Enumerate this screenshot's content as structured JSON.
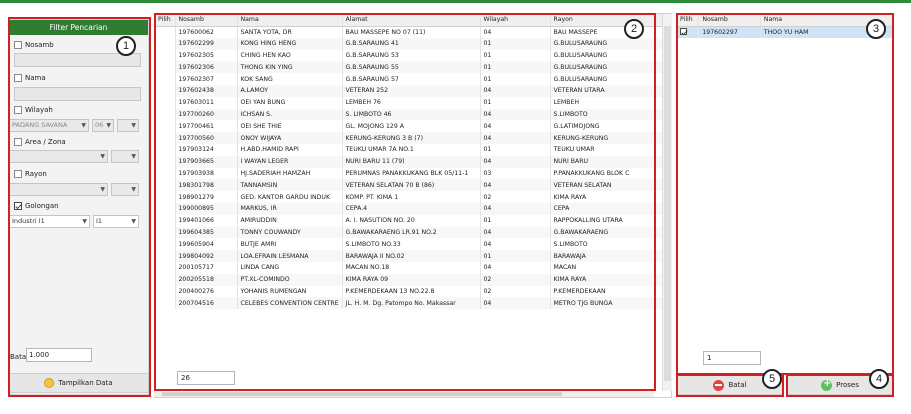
{
  "filter": {
    "title": "Filter Pencarian",
    "nosamb_label": "Nosamb",
    "nama_label": "Nama",
    "wilayah_label": "Wilayah",
    "wilayah_value": "PADANG SAVANA",
    "wilayah_code": "06",
    "area_label": "Area / Zona",
    "rayon_label": "Rayon",
    "golongan_label": "Golongan",
    "golongan_value": "Industri I1",
    "golongan_code": "I1",
    "batas_label": "Batas",
    "batas_value": "1.000",
    "show_button": "Tampilkan Data"
  },
  "main_grid": {
    "columns": [
      "Pilih",
      "Nosamb",
      "Nama",
      "Alamat",
      "Wilayah",
      "Rayon"
    ],
    "rows": [
      [
        "197600062",
        "SANTA YOTA, DR",
        "BAU MASSEPE NO 07 (11)",
        "04",
        "BAU MASSEPE"
      ],
      [
        "197602299",
        "KONG HING HENG",
        "G.B.SARAUNG 41",
        "01",
        "G.BULUSARAUNG"
      ],
      [
        "197602305",
        "CHING HEN KAO",
        "G.B.SARAUNG 53",
        "01",
        "G.BULUSARAUNG"
      ],
      [
        "197602306",
        "THONG KIN YING",
        "G.B.SARAUNG 55",
        "01",
        "G.BULUSARAUNG"
      ],
      [
        "197602307",
        "KOK SANG",
        "G.B.SARAUNG 57",
        "01",
        "G.BULUSARAUNG"
      ],
      [
        "197602438",
        "A.LAMOY",
        "VETERAN 252",
        "04",
        "VETERAN UTARA"
      ],
      [
        "197603011",
        "OEI YAN BUNG",
        "LEMBEH 76",
        "01",
        "LEMBEH"
      ],
      [
        "197700260",
        "ICHSAN S.",
        "S. LIMBOTO 46",
        "04",
        "S.LIMBOTO"
      ],
      [
        "197700461",
        "OEI SHE THIE",
        "GL. MOJONG 129 A",
        "04",
        "G.LATIMOJONG"
      ],
      [
        "197700560",
        "ONOY WIJAYA",
        "KERUNG-KERUNG 3 B (7)",
        "04",
        "KERUNG-KERUNG"
      ],
      [
        "197903124",
        "H.ABD.HAMID RAPI",
        "TEUKU UMAR 7A NO.1",
        "01",
        "TEUKU UMAR"
      ],
      [
        "197903665",
        "I WAYAN LEGER",
        "NURI BARU 11 (79)",
        "04",
        "NURI BARU"
      ],
      [
        "197903938",
        "HJ.SADERIAH HAMZAH",
        "PERUMNAS PANAKKUKANG BLK 05/11-1",
        "03",
        "P.PANAKKUKANG BLOK C"
      ],
      [
        "198301798",
        "TANNAMSIN",
        "VETERAN SELATAN 70 B (86)",
        "04",
        "VETERAN SELATAN"
      ],
      [
        "198901279",
        "GED. KANTOR GARDU INDUK",
        "KOMP. PT. KIMA 1",
        "02",
        "KIMA RAYA"
      ],
      [
        "199000895",
        "MARKUS, IR",
        "CEPA.4",
        "04",
        "CEPA"
      ],
      [
        "199401066",
        "AMIRUDDIN",
        "A. I. NASUTION NO. 20",
        "01",
        "RAPPOKALLING UTARA"
      ],
      [
        "199604385",
        "TONNY COUWANDY",
        "G.BAWAKARAENG LR.91 NO.2",
        "04",
        "G.BAWAKARAENG"
      ],
      [
        "199605904",
        "BUTJE AMRI",
        "S.LIMBOTO NO.33",
        "04",
        "S.LIMBOTO"
      ],
      [
        "199804092",
        "LOA.EFRAIN LESMANA",
        "BARAWAJA II NO.02",
        "01",
        "BARAWAJA"
      ],
      [
        "200105717",
        "LINDA CANG",
        "MACAN NO.18",
        "04",
        "MACAN"
      ],
      [
        "200205518",
        "PT.XL-COMINDO",
        "KIMA RAYA 09",
        "02",
        "KIMA RAYA"
      ],
      [
        "200400276",
        "YOHANIS RUMENGAN",
        "P.KEMERDEKAAN 13 NO.22.8",
        "02",
        "P.KEMERDEKAAN"
      ],
      [
        "200704516",
        "CELEBES CONVENTION CENTRE",
        "JL. H. M. Dg. Patompo No. Makassar",
        "04",
        "METRO TJG BUNGA"
      ]
    ],
    "row_count": "26"
  },
  "selected_grid": {
    "columns": [
      "Pilih",
      "Nosamb",
      "Nama"
    ],
    "rows": [
      [
        "197602297",
        "THOO YU HAM"
      ]
    ],
    "row_count": "1"
  },
  "buttons": {
    "cancel": "Batal",
    "process": "Proses"
  },
  "annotations": [
    "1",
    "2",
    "3",
    "4",
    "5"
  ],
  "colors": {
    "header_green": "#2e7d32",
    "annotation_red": "#d31f1f",
    "selected_row": "#cfe3f7"
  }
}
